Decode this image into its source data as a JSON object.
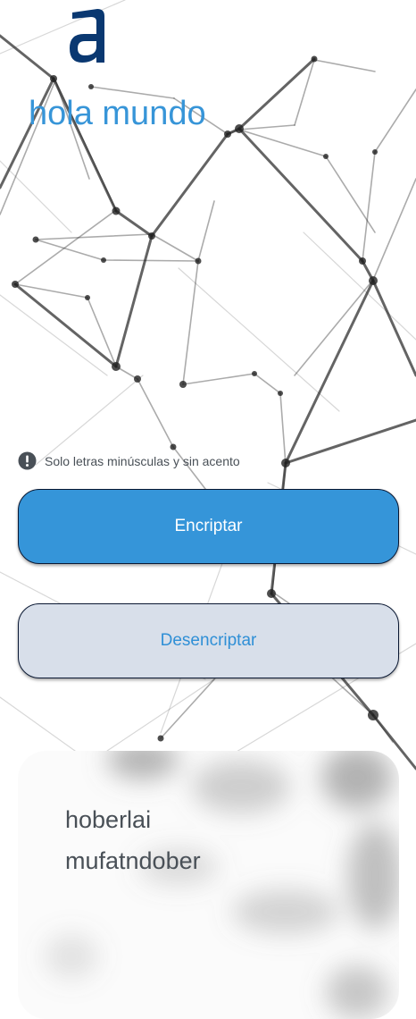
{
  "app": {
    "logo_icon": "alura-a-logo-icon",
    "brand_color": "#0a3871",
    "accent_color": "#3595d9"
  },
  "input": {
    "value": "hola mundo",
    "text_color": "#3795d8"
  },
  "hint": {
    "icon": "exclamation-circle-icon",
    "text": "Solo letras minúsculas y sin acento"
  },
  "buttons": {
    "encrypt_label": "Encriptar",
    "decrypt_label": "Desencriptar"
  },
  "output": {
    "line1": "hoberlai",
    "line2": "mufatndober"
  }
}
